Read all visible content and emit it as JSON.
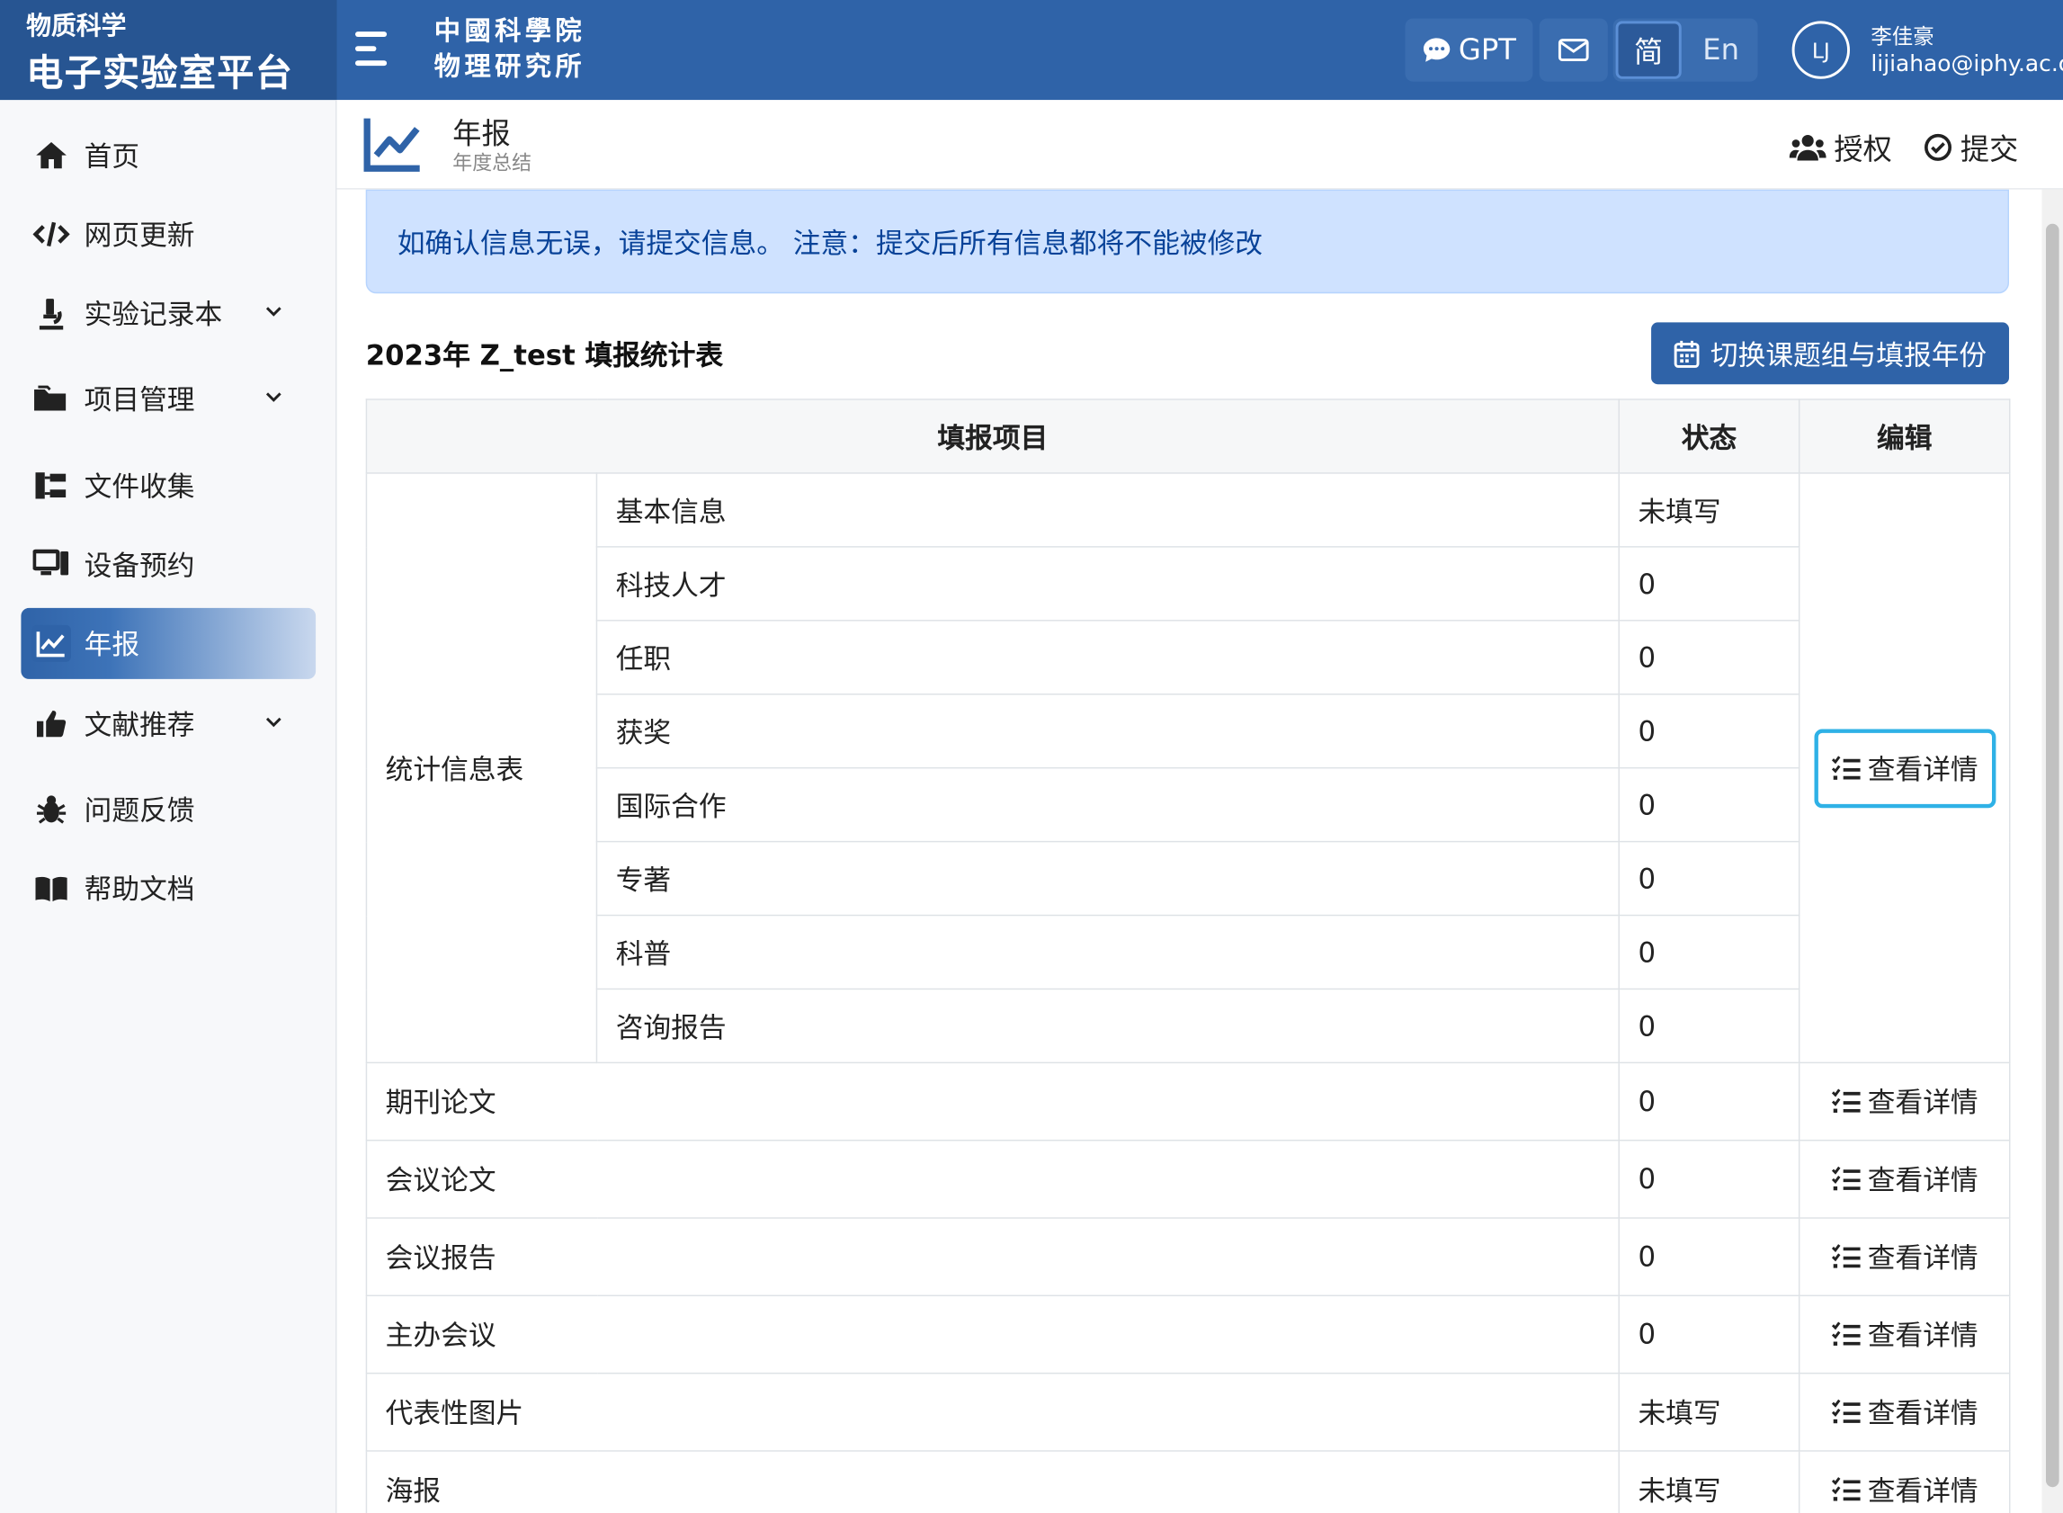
{
  "header": {
    "brand_line1": "物质科学",
    "brand_line2": "电子实验室平台",
    "institute_line1": "中國科學院",
    "institute_line2": "物理研究所",
    "gpt_label": "GPT",
    "lang_zh": "简",
    "lang_en": "En",
    "avatar_initials": "LJ",
    "user_name": "李佳豪",
    "user_email": "lijiahao@iphy.ac.cn",
    "icons": [
      "menu-icon",
      "chat-icon",
      "mail-icon"
    ]
  },
  "sidebar": {
    "items": [
      {
        "label": "首页",
        "icon": "home-icon"
      },
      {
        "label": "网页更新",
        "icon": "code-icon"
      },
      {
        "label": "实验记录本",
        "icon": "microscope-icon",
        "expandable": true
      },
      {
        "label": "项目管理",
        "icon": "folder-icon",
        "expandable": true
      },
      {
        "label": "文件收集",
        "icon": "sitemap-icon"
      },
      {
        "label": "设备预约",
        "icon": "computer-icon"
      },
      {
        "label": "年报",
        "icon": "chart-line-icon",
        "active": true
      },
      {
        "label": "文献推荐",
        "icon": "thumbs-up-icon",
        "expandable": true
      },
      {
        "label": "问题反馈",
        "icon": "bug-icon"
      },
      {
        "label": "帮助文档",
        "icon": "book-icon"
      }
    ]
  },
  "page": {
    "title": "年报",
    "subtitle": "年度总结",
    "authorize_label": "授权",
    "submit_label": "提交"
  },
  "alert": "如确认信息无误，请提交信息。 注意：提交后所有信息都将不能被修改",
  "section": {
    "title": "2023年 Z_test 填报统计表",
    "switch_button": "切换课题组与填报年份"
  },
  "table": {
    "headers": [
      "填报项目",
      "状态",
      "编辑"
    ],
    "group_label": "统计信息表",
    "group_rows": [
      {
        "item": "基本信息",
        "status": "未填写"
      },
      {
        "item": "科技人才",
        "status": "0"
      },
      {
        "item": "任职",
        "status": "0"
      },
      {
        "item": "获奖",
        "status": "0"
      },
      {
        "item": "国际合作",
        "status": "0"
      },
      {
        "item": "专著",
        "status": "0"
      },
      {
        "item": "科普",
        "status": "0"
      },
      {
        "item": "咨询报告",
        "status": "0"
      }
    ],
    "rows": [
      {
        "item": "期刊论文",
        "status": "0"
      },
      {
        "item": "会议论文",
        "status": "0"
      },
      {
        "item": "会议报告",
        "status": "0"
      },
      {
        "item": "主办会议",
        "status": "0"
      },
      {
        "item": "代表性图片",
        "status": "未填写"
      },
      {
        "item": "海报",
        "status": "未填写"
      }
    ],
    "view_label": "查看详情"
  },
  "colors": {
    "primary": "#2f63a8",
    "alert_bg": "#cfe2ff",
    "alert_text": "#084298",
    "focus_ring": "#2fb1e6"
  }
}
